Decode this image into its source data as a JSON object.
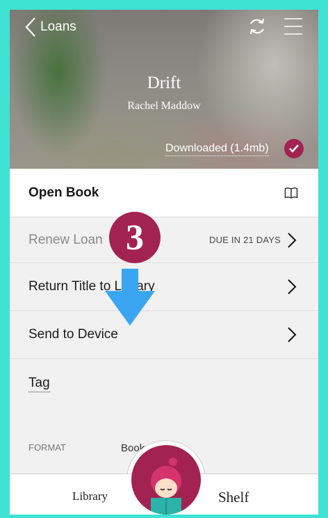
{
  "header": {
    "back_label": "Loans",
    "sync_icon": "sync-icon",
    "menu_icon": "hamburger-menu-icon"
  },
  "book": {
    "title": "Drift",
    "author": "Rachel Maddow",
    "download_status": "Downloaded (1.4mb)"
  },
  "actions": {
    "open_book": "Open Book",
    "renew_loan": "Renew Loan",
    "due_text": "DUE IN 21 DAYS",
    "return_title": "Return Title to Library",
    "send_to_device": "Send to Device",
    "tag": "Tag"
  },
  "details": {
    "format_label": "FORMAT",
    "format_value": "Book"
  },
  "bottom_nav": {
    "library": "Library",
    "shelf": "Shelf"
  },
  "annotation": {
    "step_number": "3"
  },
  "colors": {
    "frame": "#3ee3d3",
    "accent": "#a32350",
    "arrow": "#3aa6f2"
  }
}
